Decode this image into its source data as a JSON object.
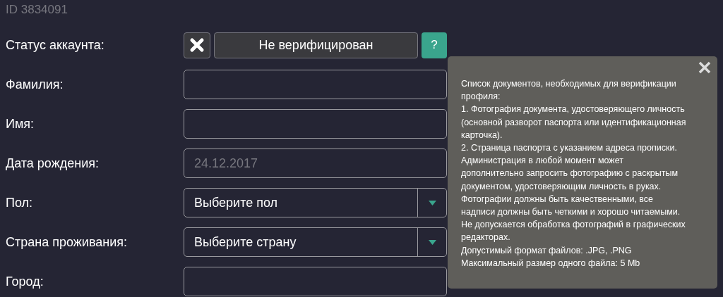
{
  "id_label": "ID 3834091",
  "status": {
    "label": "Статус аккаунта:",
    "verified": false,
    "value": "Не верифицирован",
    "help": "?"
  },
  "fields": [
    {
      "label": "Фамилия:",
      "kind": "text"
    },
    {
      "label": "Имя:",
      "kind": "text"
    },
    {
      "label": "Дата рождения:",
      "kind": "date",
      "placeholder": "24.12.2017"
    },
    {
      "label": "Пол:",
      "kind": "select",
      "value": "Выберите пол"
    },
    {
      "label": "Страна проживания:",
      "kind": "select",
      "value": "Выберите страну"
    },
    {
      "label": "Город:",
      "kind": "text"
    }
  ],
  "tooltip": {
    "lines": [
      "Список документов, необходимых для верификации",
      "профиля:",
      "1. Фотография документа, удостоверяющего личность",
      "(основной разворот паспорта или идентификационная",
      "карточка).",
      "2. Страница паспорта с указанием адреса прописки.",
      "Администрация в любой момент может",
      "дополнительно запросить фотографию с раскрытым",
      "документом, удостоверяющим личность в руках.",
      "Фотографии должны быть качественными, все",
      "надписи должны быть четкими и хорошо читаемыми.",
      "Не допускается обработка фотографий в графических",
      "редакторах.",
      "Допустимый формат файлов: .JPG, .PNG",
      "Максимальный размер одного файла: 5 Mb"
    ]
  }
}
